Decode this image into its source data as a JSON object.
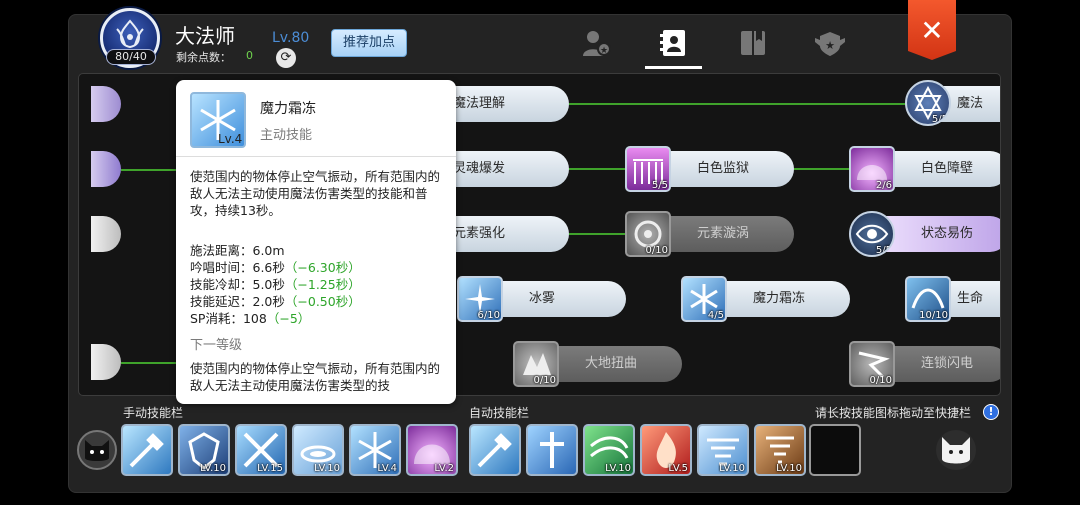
{
  "header": {
    "class_name": "大法师",
    "player_level": "80/40",
    "char_level": "Lv.80",
    "remaining_label": "剩余点数：",
    "remaining_value": "0",
    "recommend_label": "推荐加点",
    "close_label": "✕"
  },
  "tabs": [
    {
      "icon": "character-icon"
    },
    {
      "icon": "skill-book-icon",
      "active": true
    },
    {
      "icon": "codex-icon"
    },
    {
      "icon": "emblem-icon"
    }
  ],
  "tooltip": {
    "name": "魔力霜冻",
    "type": "主动技能",
    "level": "Lv.4",
    "description": "使范围内的物体停止空气振动，所有范围内的敌人无法主动使用魔法伤害类型的技能和普攻，持续13秒。",
    "stats": [
      {
        "label": "施法距离：6.0m",
        "bonus": ""
      },
      {
        "label": "吟唱时间：6.6秒",
        "bonus": "（−6.30秒）"
      },
      {
        "label": "技能冷却：5.0秒",
        "bonus": "（−1.25秒）"
      },
      {
        "label": "技能延迟：2.0秒",
        "bonus": "（−0.50秒）"
      },
      {
        "label": "SP消耗：108",
        "bonus": "（−5）"
      }
    ],
    "next_label": "下一等级",
    "next_description": "使范围内的物体停止空气振动，所有范围内的敌人无法主动使用魔法伤害类型的技"
  },
  "tree": [
    {
      "name": "魔法理解",
      "level": "",
      "locked": false
    },
    {
      "name": "魔法",
      "level": "5/5",
      "locked": false
    },
    {
      "name": "灵魂爆发",
      "level": "",
      "locked": false
    },
    {
      "name": "白色监狱",
      "level": "5/5",
      "locked": false
    },
    {
      "name": "白色障壁",
      "level": "2/6",
      "locked": false
    },
    {
      "name": "元素强化",
      "level": "",
      "locked": false
    },
    {
      "name": "元素漩涡",
      "level": "0/10",
      "locked": true
    },
    {
      "name": "状态易伤",
      "level": "5/5",
      "locked": false
    },
    {
      "name": "冰雾",
      "level": "6/10",
      "locked": false
    },
    {
      "name": "魔力霜冻",
      "level": "4/5",
      "locked": false
    },
    {
      "name": "生命",
      "level": "10/10",
      "locked": false
    },
    {
      "name": "大地扭曲",
      "level": "0/10",
      "locked": true
    },
    {
      "name": "连锁闪电",
      "level": "0/10",
      "locked": true
    }
  ],
  "manual_bar": {
    "label": "手动技能栏",
    "slots": [
      {
        "level": ""
      },
      {
        "level": "LV.10"
      },
      {
        "level": "LV.15"
      },
      {
        "level": "LV.10"
      },
      {
        "level": "LV.4"
      },
      {
        "level": "LV.2"
      }
    ]
  },
  "auto_bar": {
    "label": "自动技能栏",
    "slots": [
      {
        "level": ""
      },
      {
        "level": ""
      },
      {
        "level": "LV.10"
      },
      {
        "level": "LV.5"
      },
      {
        "level": "LV.10"
      },
      {
        "level": "LV.10"
      }
    ]
  },
  "hint": "请长按技能图标拖动至快捷栏",
  "colors": {
    "accent_green": "#3fa32b",
    "bonus_green": "#2ea52a",
    "close_red": "#e0421c",
    "level_blue": "#4c8dd6"
  }
}
